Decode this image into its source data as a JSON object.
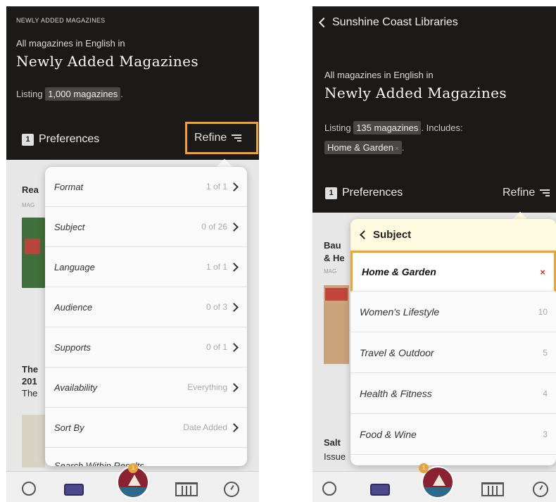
{
  "left": {
    "smallcap": "NEWLY ADDED MAGAZINES",
    "subtitle": "All magazines in English in",
    "title": "Newly Added Magazines",
    "listing_prefix": "Listing",
    "listing_count": "1,000 magazines",
    "listing_suffix": ".",
    "preferences_count": "1",
    "preferences_label": "Preferences",
    "refine_label": "Refine",
    "bg_items": [
      "Rea",
      "The",
      "201",
      "The"
    ],
    "bg_small": "MAG",
    "menu": [
      {
        "label": "Format",
        "value": "1 of 1"
      },
      {
        "label": "Subject",
        "value": "0 of 26"
      },
      {
        "label": "Language",
        "value": "1 of 1"
      },
      {
        "label": "Audience",
        "value": "0 of 3"
      },
      {
        "label": "Supports",
        "value": "0 of 1"
      },
      {
        "label": "Availability",
        "value": "Everything"
      },
      {
        "label": "Sort By",
        "value": "Date Added"
      },
      {
        "label": "Search Within Results...",
        "value": ""
      }
    ],
    "notif_count": "1"
  },
  "right": {
    "back_label": "Sunshine Coast Libraries",
    "subtitle": "All magazines in English in",
    "title": "Newly Added Magazines",
    "listing_prefix": "Listing",
    "listing_count": "135 magazines",
    "listing_suffix": ". Includes:",
    "filter_chip": "Home & Garden",
    "filter_chip_x": "×",
    "filter_suffix": ".",
    "preferences_count": "1",
    "preferences_label": "Preferences",
    "refine_label": "Refine",
    "bg_items": [
      "Bau",
      "& He",
      "Salt",
      "Issue"
    ],
    "bg_small": "MAG",
    "popover_header": "Subject",
    "subjects": [
      {
        "label": "Home & Garden",
        "count": "×"
      },
      {
        "label": "Women's Lifestyle",
        "count": "10"
      },
      {
        "label": "Travel & Outdoor",
        "count": "5"
      },
      {
        "label": "Health & Fitness",
        "count": "4"
      },
      {
        "label": "Food & Wine",
        "count": "3"
      }
    ],
    "notif_count": "1"
  },
  "colors": {
    "header_bg": "#1c1a19",
    "highlight": "#f2a22c",
    "popover_header_bg": "#fffbe0",
    "remove_x": "#dd3333"
  }
}
